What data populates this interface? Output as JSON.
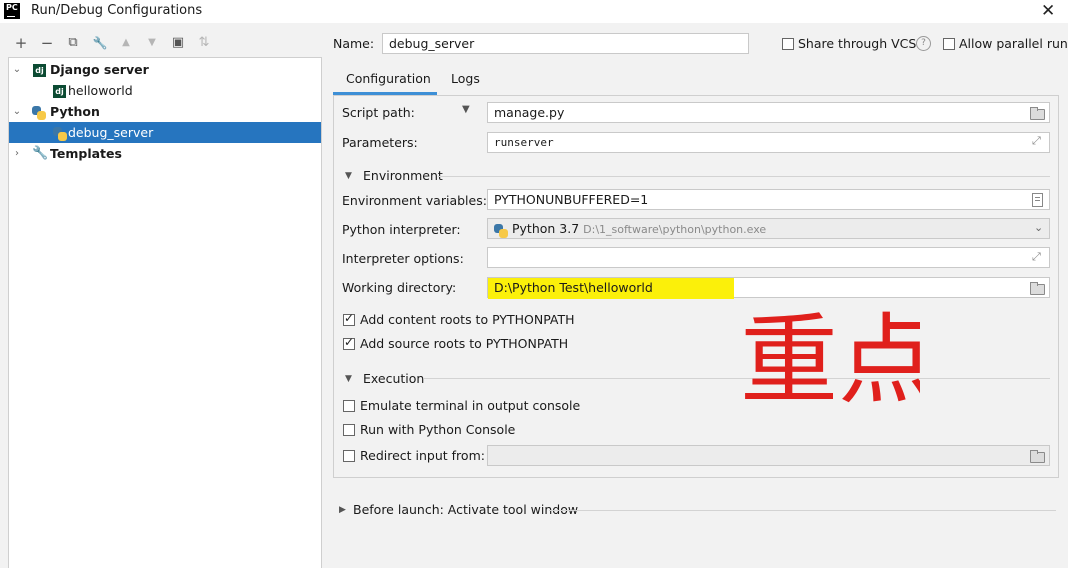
{
  "window": {
    "title": "Run/Debug Configurations",
    "logo_text": "PC"
  },
  "toolbar": {
    "icons": [
      "add-icon",
      "remove-icon",
      "copy-icon",
      "edit-defaults-icon",
      "move-up-icon",
      "move-down-icon",
      "new-folder-icon",
      "sort-icon"
    ],
    "glyphs": [
      "+",
      "−",
      "⧉",
      "🔧",
      "▲",
      "▼",
      "▣",
      "⇅"
    ]
  },
  "tree": {
    "items": [
      {
        "label": "Django server",
        "bold": true
      },
      {
        "label": "helloworld"
      },
      {
        "label": "Python",
        "bold": true
      },
      {
        "label": "debug_server",
        "selected": true
      },
      {
        "label": "Templates",
        "bold": true
      }
    ],
    "dj_badge": "dj"
  },
  "header": {
    "name_label": "Name:",
    "name_value": "debug_server",
    "share_vcs": "Share through VCS",
    "help": "?",
    "allow_parallel": "Allow parallel run"
  },
  "tabs": [
    {
      "label": "Configuration",
      "active": true
    },
    {
      "label": "Logs"
    }
  ],
  "config": {
    "script_path_label": "Script path:",
    "script_path_value": "manage.py",
    "parameters_label": "Parameters:",
    "parameters_value": "runserver",
    "environment_section": "Environment",
    "env_vars_label": "Environment variables:",
    "env_vars_value": "PYTHONUNBUFFERED=1",
    "interpreter_label": "Python interpreter:",
    "interpreter_name": "Python 3.7",
    "interpreter_path": "D:\\1_software\\python\\python.exe",
    "interp_options_label": "Interpreter options:",
    "interp_options_value": "",
    "working_dir_label": "Working directory:",
    "working_dir_value": "D:\\Python Test\\helloworld",
    "add_content_roots": "Add content roots to PYTHONPATH",
    "add_source_roots": "Add source roots to PYTHONPATH",
    "execution_section": "Execution",
    "emulate_terminal": "Emulate terminal in output console",
    "run_python_console": "Run with Python Console",
    "redirect_input": "Redirect input from:",
    "redirect_input_value": ""
  },
  "before_launch": {
    "label": "Before launch: Activate tool window"
  },
  "annotation": {
    "text": "重点",
    "color": "#e0201c"
  },
  "colors": {
    "selection": "#2675bf",
    "highlight": "#fbf00a",
    "tab_underline": "#3d8fd6"
  }
}
